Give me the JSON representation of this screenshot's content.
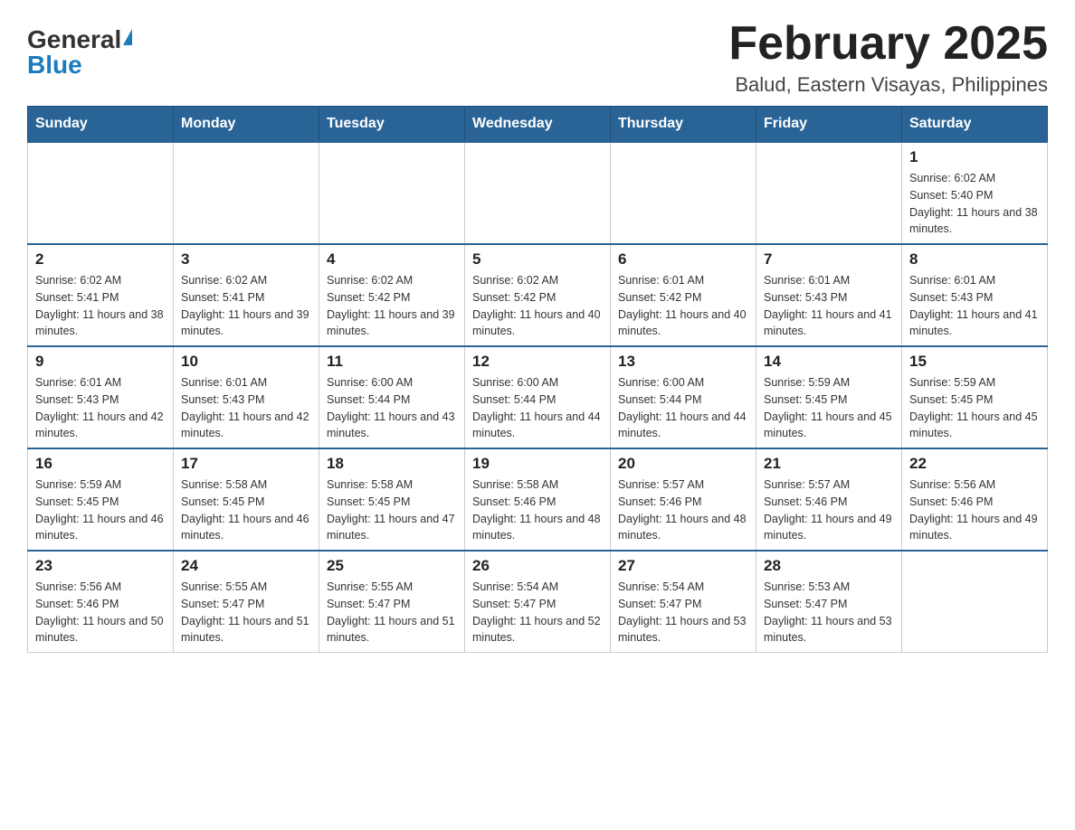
{
  "logo": {
    "general": "General",
    "blue": "Blue",
    "alt": "GeneralBlue logo"
  },
  "title": {
    "month_year": "February 2025",
    "location": "Balud, Eastern Visayas, Philippines"
  },
  "header": {
    "days": [
      "Sunday",
      "Monday",
      "Tuesday",
      "Wednesday",
      "Thursday",
      "Friday",
      "Saturday"
    ]
  },
  "weeks": [
    {
      "days": [
        {
          "number": "",
          "info": ""
        },
        {
          "number": "",
          "info": ""
        },
        {
          "number": "",
          "info": ""
        },
        {
          "number": "",
          "info": ""
        },
        {
          "number": "",
          "info": ""
        },
        {
          "number": "",
          "info": ""
        },
        {
          "number": "1",
          "info": "Sunrise: 6:02 AM\nSunset: 5:40 PM\nDaylight: 11 hours and 38 minutes."
        }
      ]
    },
    {
      "days": [
        {
          "number": "2",
          "info": "Sunrise: 6:02 AM\nSunset: 5:41 PM\nDaylight: 11 hours and 38 minutes."
        },
        {
          "number": "3",
          "info": "Sunrise: 6:02 AM\nSunset: 5:41 PM\nDaylight: 11 hours and 39 minutes."
        },
        {
          "number": "4",
          "info": "Sunrise: 6:02 AM\nSunset: 5:42 PM\nDaylight: 11 hours and 39 minutes."
        },
        {
          "number": "5",
          "info": "Sunrise: 6:02 AM\nSunset: 5:42 PM\nDaylight: 11 hours and 40 minutes."
        },
        {
          "number": "6",
          "info": "Sunrise: 6:01 AM\nSunset: 5:42 PM\nDaylight: 11 hours and 40 minutes."
        },
        {
          "number": "7",
          "info": "Sunrise: 6:01 AM\nSunset: 5:43 PM\nDaylight: 11 hours and 41 minutes."
        },
        {
          "number": "8",
          "info": "Sunrise: 6:01 AM\nSunset: 5:43 PM\nDaylight: 11 hours and 41 minutes."
        }
      ]
    },
    {
      "days": [
        {
          "number": "9",
          "info": "Sunrise: 6:01 AM\nSunset: 5:43 PM\nDaylight: 11 hours and 42 minutes."
        },
        {
          "number": "10",
          "info": "Sunrise: 6:01 AM\nSunset: 5:43 PM\nDaylight: 11 hours and 42 minutes."
        },
        {
          "number": "11",
          "info": "Sunrise: 6:00 AM\nSunset: 5:44 PM\nDaylight: 11 hours and 43 minutes."
        },
        {
          "number": "12",
          "info": "Sunrise: 6:00 AM\nSunset: 5:44 PM\nDaylight: 11 hours and 44 minutes."
        },
        {
          "number": "13",
          "info": "Sunrise: 6:00 AM\nSunset: 5:44 PM\nDaylight: 11 hours and 44 minutes."
        },
        {
          "number": "14",
          "info": "Sunrise: 5:59 AM\nSunset: 5:45 PM\nDaylight: 11 hours and 45 minutes."
        },
        {
          "number": "15",
          "info": "Sunrise: 5:59 AM\nSunset: 5:45 PM\nDaylight: 11 hours and 45 minutes."
        }
      ]
    },
    {
      "days": [
        {
          "number": "16",
          "info": "Sunrise: 5:59 AM\nSunset: 5:45 PM\nDaylight: 11 hours and 46 minutes."
        },
        {
          "number": "17",
          "info": "Sunrise: 5:58 AM\nSunset: 5:45 PM\nDaylight: 11 hours and 46 minutes."
        },
        {
          "number": "18",
          "info": "Sunrise: 5:58 AM\nSunset: 5:45 PM\nDaylight: 11 hours and 47 minutes."
        },
        {
          "number": "19",
          "info": "Sunrise: 5:58 AM\nSunset: 5:46 PM\nDaylight: 11 hours and 48 minutes."
        },
        {
          "number": "20",
          "info": "Sunrise: 5:57 AM\nSunset: 5:46 PM\nDaylight: 11 hours and 48 minutes."
        },
        {
          "number": "21",
          "info": "Sunrise: 5:57 AM\nSunset: 5:46 PM\nDaylight: 11 hours and 49 minutes."
        },
        {
          "number": "22",
          "info": "Sunrise: 5:56 AM\nSunset: 5:46 PM\nDaylight: 11 hours and 49 minutes."
        }
      ]
    },
    {
      "days": [
        {
          "number": "23",
          "info": "Sunrise: 5:56 AM\nSunset: 5:46 PM\nDaylight: 11 hours and 50 minutes."
        },
        {
          "number": "24",
          "info": "Sunrise: 5:55 AM\nSunset: 5:47 PM\nDaylight: 11 hours and 51 minutes."
        },
        {
          "number": "25",
          "info": "Sunrise: 5:55 AM\nSunset: 5:47 PM\nDaylight: 11 hours and 51 minutes."
        },
        {
          "number": "26",
          "info": "Sunrise: 5:54 AM\nSunset: 5:47 PM\nDaylight: 11 hours and 52 minutes."
        },
        {
          "number": "27",
          "info": "Sunrise: 5:54 AM\nSunset: 5:47 PM\nDaylight: 11 hours and 53 minutes."
        },
        {
          "number": "28",
          "info": "Sunrise: 5:53 AM\nSunset: 5:47 PM\nDaylight: 11 hours and 53 minutes."
        },
        {
          "number": "",
          "info": ""
        }
      ]
    }
  ]
}
